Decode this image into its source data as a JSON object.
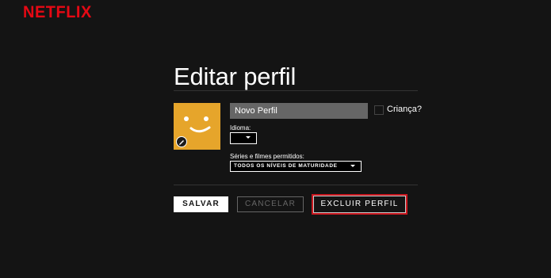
{
  "brand": {
    "logo_text": "NETFLIX",
    "color": "#e50914"
  },
  "page": {
    "title": "Editar perfil"
  },
  "profile": {
    "avatar_color": "#e6a52b",
    "avatar_icon": "smiley-face-icon",
    "edit_icon": "pencil-icon",
    "name_value": "Novo Perfil",
    "kids_label": "Criança?",
    "kids_checked": false
  },
  "language": {
    "label": "Idioma:",
    "selected": ""
  },
  "maturity": {
    "label": "Séries e filmes permitidos:",
    "selected": "TODOS OS NÍVEIS DE MATURIDADE"
  },
  "actions": {
    "save_label": "SALVAR",
    "cancel_label": "CANCELAR",
    "delete_label": "EXCLUIR PERFIL",
    "delete_highlight_color": "#c9161e"
  }
}
